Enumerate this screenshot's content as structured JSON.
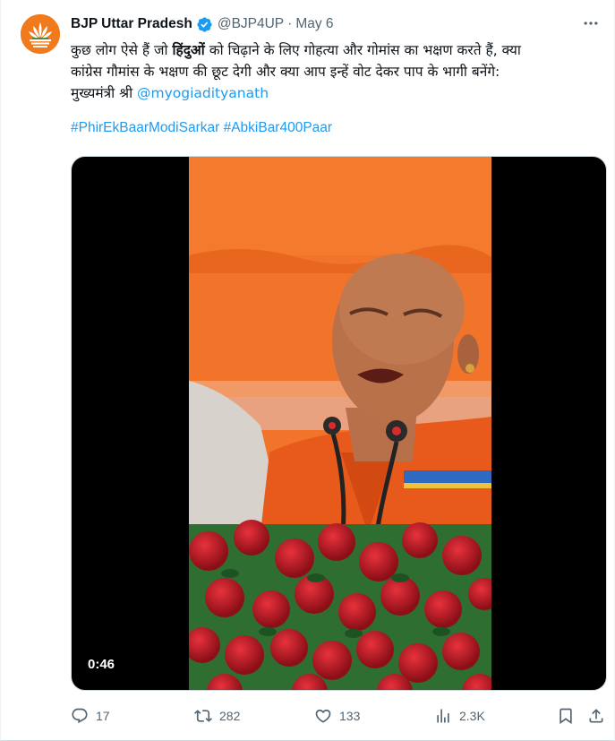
{
  "author": {
    "name": "BJP Uttar Pradesh",
    "handle": "@BJP4UP",
    "separator": "·",
    "date": "May 6"
  },
  "tweet": {
    "line1_pre": "कुछ लोग ऐसे हैं जो ",
    "line1_bold": "हिंदुओं",
    "line1_post": " को चिढ़ाने के लिए गोहत्या और गोमांस का भक्षण करते हैं, क्या",
    "line2": "कांग्रेस गौमांस के भक्षण की छूट देगी और क्या आप इन्हें वोट देकर पाप के भागी बनेंगे:",
    "line3_pre": "मुख्यमंत्री श्री ",
    "mention": "@myogiadityanath",
    "hashtag1": "#PhirEkBaarModiSarkar",
    "hashtag2": "#AbkiBar400Paar"
  },
  "media": {
    "duration": "0:46"
  },
  "actions": {
    "replies": "17",
    "reposts": "282",
    "likes": "133",
    "views": "2.3K"
  },
  "colors": {
    "link": "#1d9bf0",
    "verified": "#1d9bf0",
    "muted": "#536471",
    "avatar_bg": "#f07a1c"
  },
  "icons": [
    "bjp-lotus-logo-icon",
    "verified-badge-icon",
    "more-icon",
    "reply-icon",
    "repost-icon",
    "like-icon",
    "views-icon",
    "bookmark-icon",
    "share-icon"
  ]
}
